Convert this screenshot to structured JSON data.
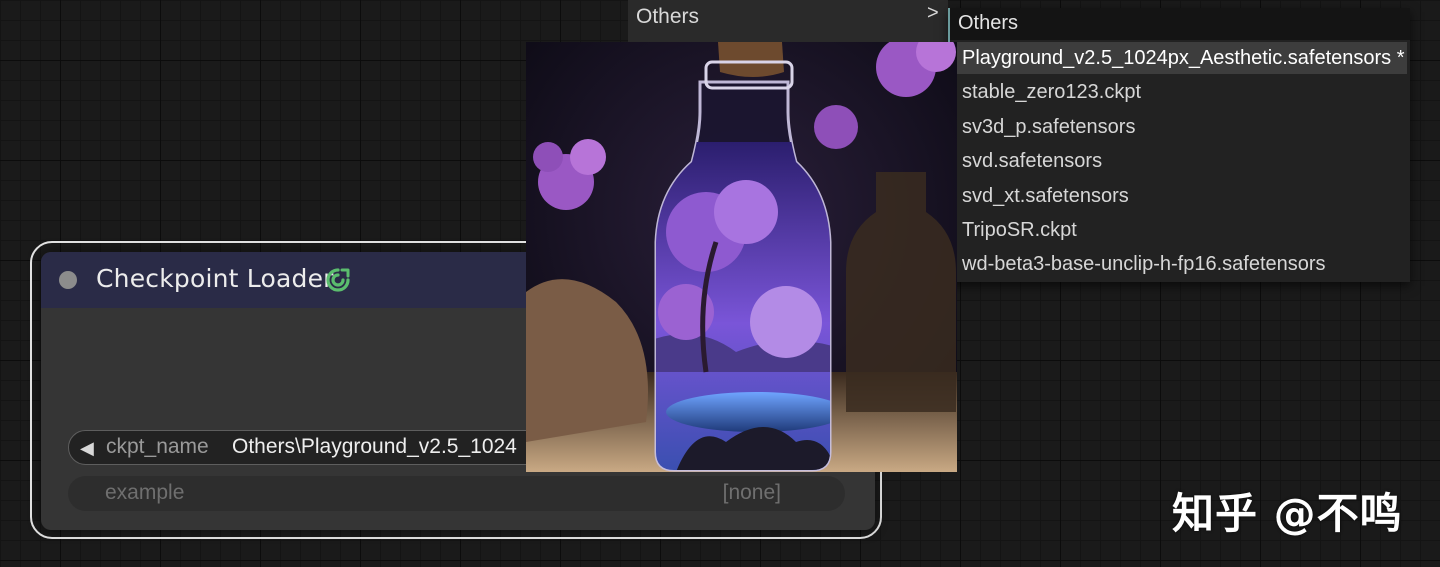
{
  "node": {
    "title": "Checkpoint Loader",
    "badge_icon": "comfy-logo-icon",
    "widgets": [
      {
        "name": "ckpt_name",
        "value": "Others\\Playground_v2.5_1024"
      },
      {
        "name": "example",
        "value": "[none]"
      }
    ]
  },
  "submenu": {
    "label": "Others",
    "arrow": ">"
  },
  "dropdown": {
    "title": "Others",
    "items": [
      "Playground_v2.5_1024px_Aesthetic.safetensors *",
      "stable_zero123.ckpt",
      "sv3d_p.safetensors",
      "svd.safetensors",
      "svd_xt.safetensors",
      "TripoSR.ckpt",
      "wd-beta3-base-unclip-h-fp16.safetensors"
    ],
    "selected_index": 0
  },
  "preview": {
    "subject": "purple-tree-bottle-image"
  },
  "watermark": "知乎 @不鸣",
  "colors": {
    "canvas": "#1a1a1a",
    "node_header": "#2a2b47",
    "node_body": "#353535",
    "badge": "#5bbd6e",
    "dropdown_bg": "#222222",
    "accent_border": "#6a9a9c"
  }
}
